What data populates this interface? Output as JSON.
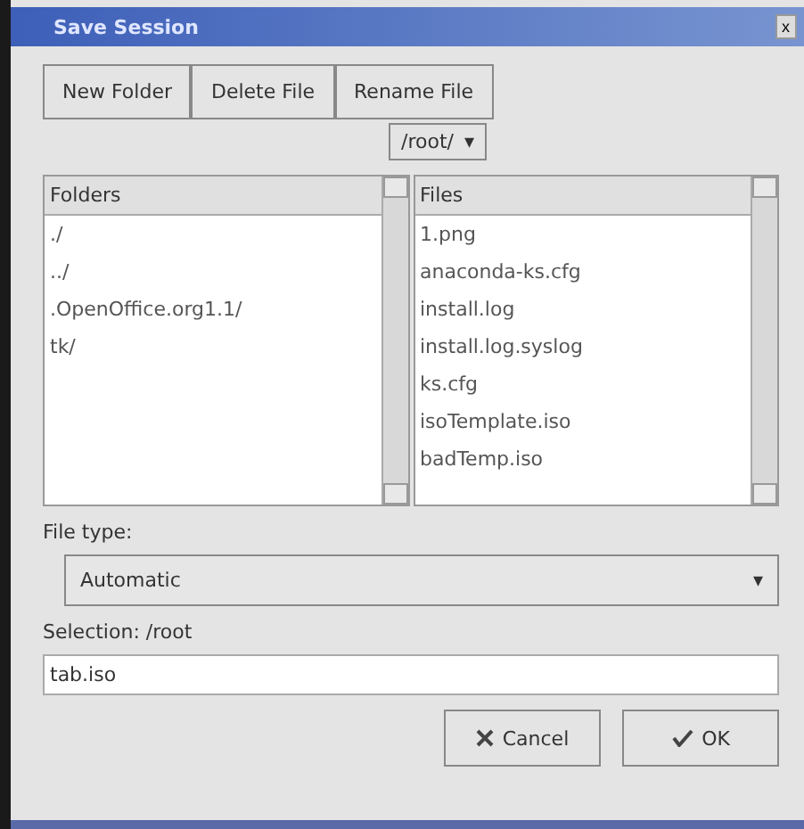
{
  "window": {
    "title": "Save Session",
    "close": "x"
  },
  "toolbar": [
    "New Folder",
    "Delete File",
    "Rename File"
  ],
  "path_menu": {
    "value": "/root/",
    "arrow": "▾"
  },
  "folders": {
    "heading": "Folders",
    "items": [
      {
        "label": "./",
        "selected": false
      },
      {
        "label": "../",
        "selected": false
      },
      {
        "label": ".OpenOffice.org1.1/",
        "selected": false
      },
      {
        "label": "tk/",
        "selected": false
      }
    ]
  },
  "files": {
    "heading": "Files",
    "items": [
      {
        "label": "1.png",
        "selected": false
      },
      {
        "label": "anaconda-ks.cfg",
        "selected": false
      },
      {
        "label": "install.log",
        "selected": false
      },
      {
        "label": "install.log.syslog",
        "selected": false
      },
      {
        "label": "ks.cfg",
        "selected": false
      },
      {
        "label": "isoTemplate.iso",
        "selected": false
      },
      {
        "label": "badTemp.iso",
        "selected": false
      }
    ]
  },
  "file_type": {
    "label": "File type:",
    "value": "Automatic",
    "arrow": "▾"
  },
  "selection": {
    "label": "Selection: /root",
    "value": "tab.iso"
  },
  "buttons": [
    {
      "kind": "cancel",
      "label": "Cancel"
    },
    {
      "kind": "ok",
      "label": "OK"
    }
  ]
}
